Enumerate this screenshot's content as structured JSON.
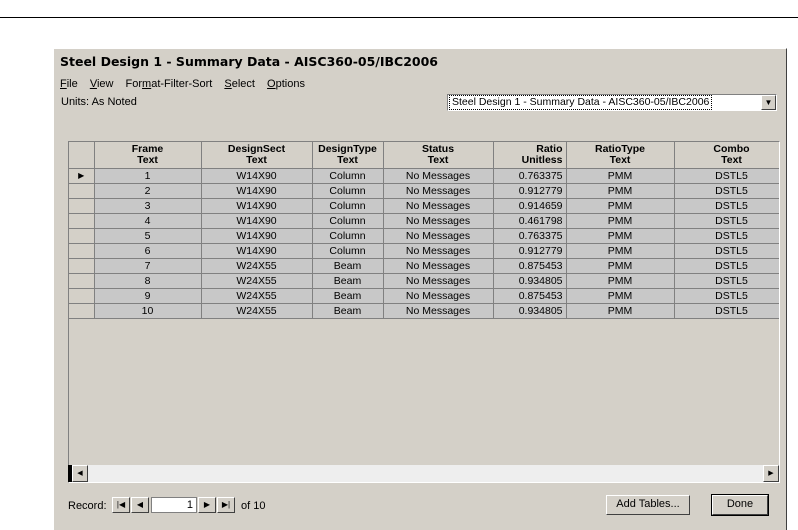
{
  "window": {
    "title": "Steel Design 1 - Summary Data - AISC360-05/IBC2006"
  },
  "menu": [
    {
      "pre": "",
      "ul": "F",
      "post": "ile"
    },
    {
      "pre": "",
      "ul": "V",
      "post": "iew"
    },
    {
      "pre": "For",
      "ul": "m",
      "post": "at-Filter-Sort"
    },
    {
      "pre": "",
      "ul": "S",
      "post": "elect"
    },
    {
      "pre": "",
      "ul": "O",
      "post": "ptions"
    }
  ],
  "units_label": "Units: As Noted",
  "table_select": {
    "value": "Steel Design 1 - Summary Data - AISC360-05/IBC2006"
  },
  "columns": [
    {
      "line1": "Frame",
      "line2": "Text"
    },
    {
      "line1": "DesignSect",
      "line2": "Text"
    },
    {
      "line1": "DesignType",
      "line2": "Text"
    },
    {
      "line1": "Status",
      "line2": "Text"
    },
    {
      "line1": "Ratio",
      "line2": "Unitless"
    },
    {
      "line1": "RatioType",
      "line2": "Text"
    },
    {
      "line1": "Combo",
      "line2": "Text"
    }
  ],
  "rows": [
    [
      "1",
      "W14X90",
      "Column",
      "No Messages",
      "0.763375",
      "PMM",
      "DSTL5"
    ],
    [
      "2",
      "W14X90",
      "Column",
      "No Messages",
      "0.912779",
      "PMM",
      "DSTL5"
    ],
    [
      "3",
      "W14X90",
      "Column",
      "No Messages",
      "0.914659",
      "PMM",
      "DSTL5"
    ],
    [
      "4",
      "W14X90",
      "Column",
      "No Messages",
      "0.461798",
      "PMM",
      "DSTL5"
    ],
    [
      "5",
      "W14X90",
      "Column",
      "No Messages",
      "0.763375",
      "PMM",
      "DSTL5"
    ],
    [
      "6",
      "W14X90",
      "Column",
      "No Messages",
      "0.912779",
      "PMM",
      "DSTL5"
    ],
    [
      "7",
      "W24X55",
      "Beam",
      "No Messages",
      "0.875453",
      "PMM",
      "DSTL5"
    ],
    [
      "8",
      "W24X55",
      "Beam",
      "No Messages",
      "0.934805",
      "PMM",
      "DSTL5"
    ],
    [
      "9",
      "W24X55",
      "Beam",
      "No Messages",
      "0.875453",
      "PMM",
      "DSTL5"
    ],
    [
      "10",
      "W24X55",
      "Beam",
      "No Messages",
      "0.934805",
      "PMM",
      "DSTL5"
    ]
  ],
  "record": {
    "label": "Record:",
    "current": "1",
    "of_text": "of 10"
  },
  "buttons": {
    "add_tables": "Add Tables...",
    "done": "Done"
  },
  "colors": {
    "window_face": "#d4d0c8",
    "cell_fill": "#c8c8c8"
  },
  "icons": {
    "row_selector": "triangle-right",
    "nav_first": "first-record",
    "nav_prev": "prev-record",
    "nav_next": "next-record",
    "nav_last": "last-record"
  }
}
